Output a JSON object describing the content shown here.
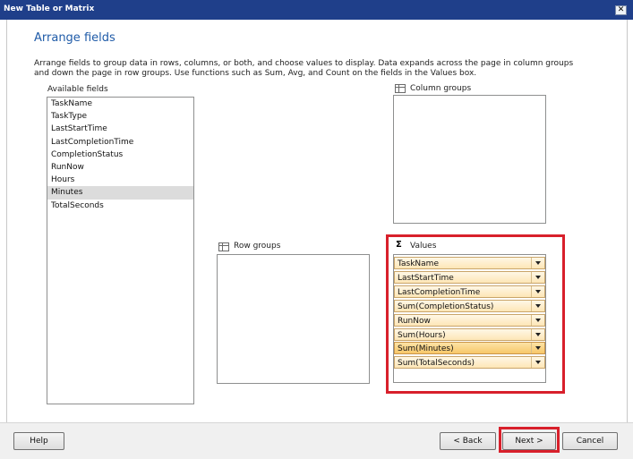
{
  "window": {
    "title": "New Table or Matrix",
    "close_glyph": "✕"
  },
  "page": {
    "heading": "Arrange fields",
    "description": "Arrange fields to group data in rows, columns, or both, and choose values to display. Data expands across the page in column groups and down the page in row groups.  Use functions such as Sum, Avg, and Count on the fields in the Values box."
  },
  "available_fields": {
    "label": "Available fields",
    "selected": "Minutes",
    "items": [
      "TaskName",
      "TaskType",
      "LastStartTime",
      "LastCompletionTime",
      "CompletionStatus",
      "RunNow",
      "Hours",
      "Minutes",
      "TotalSeconds"
    ]
  },
  "column_groups": {
    "label": "Column groups",
    "icon": "grid-icon"
  },
  "row_groups": {
    "label": "Row groups",
    "icon": "grid-icon"
  },
  "values": {
    "label": "Values",
    "icon": "sigma-icon",
    "sigma_glyph": "Σ",
    "highlight_color": "#d8202b",
    "items": [
      "TaskName",
      "LastStartTime",
      "LastCompletionTime",
      "Sum(CompletionStatus)",
      "RunNow",
      "Sum(Hours)",
      "Sum(Minutes)",
      "Sum(TotalSeconds)"
    ],
    "highlighted": "Sum(Minutes)"
  },
  "footer": {
    "help": "Help",
    "back": "< Back",
    "next": "Next >",
    "cancel": "Cancel"
  }
}
